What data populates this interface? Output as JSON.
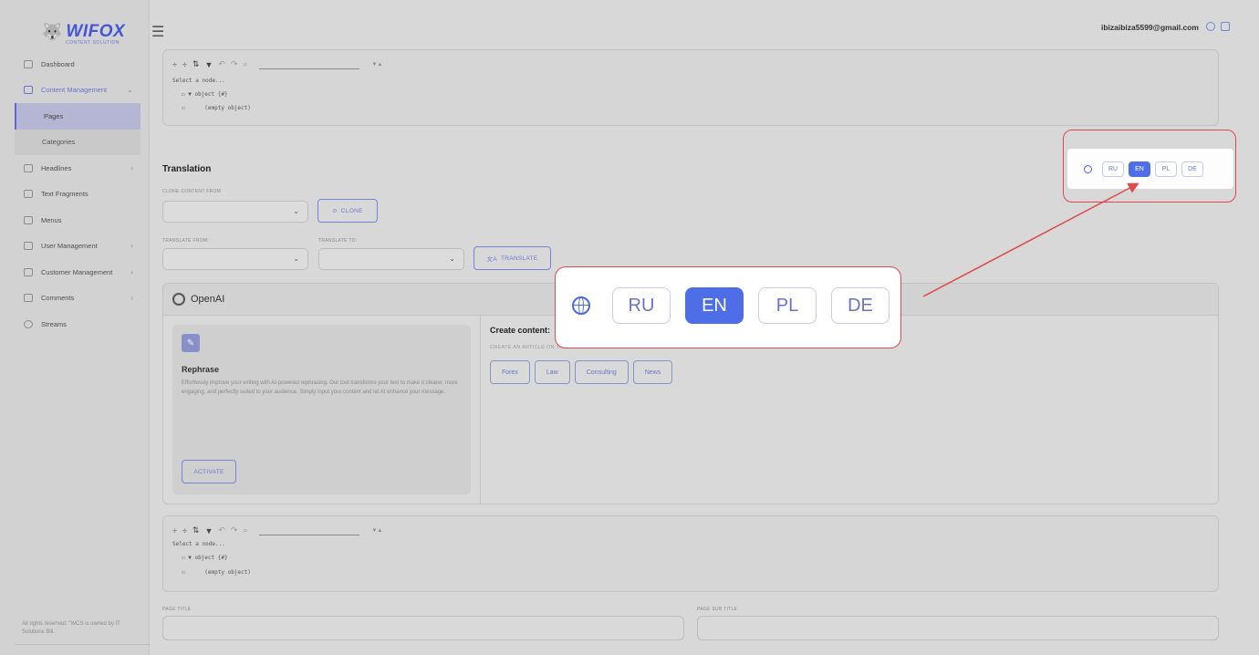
{
  "app": {
    "logo_text": "WIFOX",
    "logo_sub": "CONTENT SOLUTION"
  },
  "sidebar": {
    "items": [
      {
        "label": "Dashboard"
      },
      {
        "label": "Content Management"
      },
      {
        "label": "Pages"
      },
      {
        "label": "Categories"
      },
      {
        "label": "Headlines"
      },
      {
        "label": "Text Fragments"
      },
      {
        "label": "Menus"
      },
      {
        "label": "User Management"
      },
      {
        "label": "Customer Management"
      },
      {
        "label": "Comments"
      },
      {
        "label": "Streams"
      }
    ],
    "footer": "All rights reserved. \"WCS is owned by IT Solutions Bill."
  },
  "header": {
    "user_email": "ibizaibiza5599@gmail.com"
  },
  "json_editor": {
    "select_node": "Select a node...",
    "object_line": "▼ object {#}",
    "empty_line": "(empty object)"
  },
  "translation": {
    "title": "Translation",
    "clone_from_label": "CLONE CONTENT FROM",
    "clone_button": "CLONE",
    "translate_from_label": "TRANSLATE FROM:",
    "translate_to_label": "TRANSLATE TO:",
    "translate_button": "TRANSLATE"
  },
  "openai": {
    "title": "OpenAI",
    "rephrase_title": "Rephrase",
    "rephrase_desc": "Effortlessly improve your writing with AI-powered rephrasing. Our tool transforms your text to make it clearer, more engaging, and perfectly suited to your audience. Simply input your content and let AI enhance your message.",
    "activate_button": "ACTIVATE",
    "create_title": "Create content:",
    "create_sub": "CREATE AN ARTICLE ON THE TOPIC",
    "topics": [
      "Forex",
      "Law",
      "Consulting",
      "News"
    ]
  },
  "page_fields": {
    "page_title_label": "PAGE TITLE",
    "page_sub_title_label": "PAGE SUB TITLE"
  },
  "language_switcher": {
    "languages": [
      "RU",
      "EN",
      "PL",
      "DE"
    ],
    "active": "EN"
  },
  "colors": {
    "accent": "#4f6fe8",
    "annotation": "#e04a4a"
  }
}
